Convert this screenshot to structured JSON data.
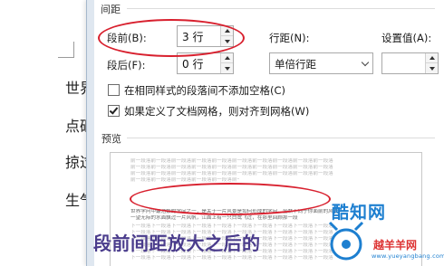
{
  "document": {
    "lines": [
      "世界",
      "点砸",
      "掠过",
      "生气"
    ]
  },
  "dialog": {
    "spacing_section": "间距",
    "before": {
      "label": "段前(B):",
      "value": "3 行"
    },
    "after": {
      "label": "段后(F):",
      "value": "0 行"
    },
    "line_spacing": {
      "label": "行距(N):",
      "value": "单倍行距"
    },
    "setting_value": {
      "label": "设置值(A):",
      "value": ""
    },
    "no_space_same_style": {
      "label": "在相同样式的段落间不添加空格(C)",
      "checked": false
    },
    "snap_to_grid": {
      "label": "如果定义了文档网格，则对齐到网格(W)",
      "checked": true
    }
  },
  "preview": {
    "title": "预览",
    "prev_text": "前一段落前一段落前一段落前一段落前一段落前一段落前一段落前一段落前一段落前一段落",
    "body_text": "世界学问中最浩繁的学问之一，是关于一片风景是如何形成的学问，全然不同于你面前的风景",
    "body_text2": "一望无际的水面飘过一片风帆，江面上有一只白鹭飞过，在那里回顾那一段",
    "next_text": "下一段落下一段落下一段落下一段落下一段落下一段落下一段落下一段落下一段落下一段落"
  },
  "annotation": {
    "caption": "段前间距放大之后的",
    "color": "#d8202e"
  },
  "watermark": {
    "brand": "酷知网",
    "site_cn": "越羊羊网",
    "url": "www.yueyangbang.com"
  }
}
